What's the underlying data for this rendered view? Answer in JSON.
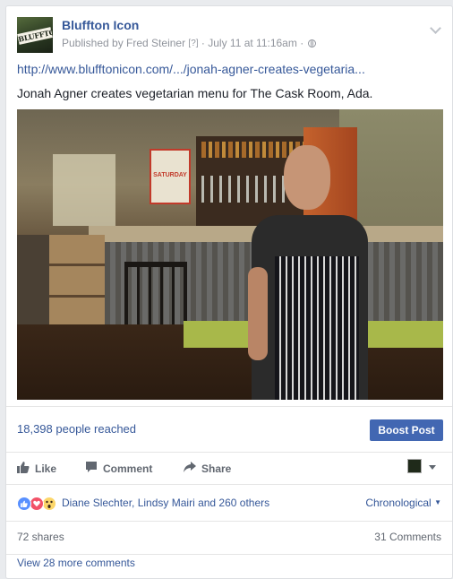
{
  "post": {
    "page_name": "Bluffton Icon",
    "avatar_text": "BLUFFTON",
    "published_by": "Published by Fred Steiner",
    "help_marker": "[?]",
    "separator": "·",
    "timestamp": "July 11 at 11:16am",
    "privacy_icon": "globe-icon",
    "link": "http://www.blufftonicon.com/.../jonah-agner-creates-vegetaria...",
    "caption": "Jonah Agner creates vegetarian menu for The Cask Room, Ada.",
    "photo_icon": "restaurant-photo",
    "poster_text": "SATURDAY"
  },
  "insights": {
    "reach": "18,398 people reached",
    "boost_label": "Boost Post"
  },
  "actions": {
    "like": "Like",
    "comment": "Comment",
    "share": "Share"
  },
  "reactions": {
    "icons": [
      "like-icon",
      "love-icon",
      "wow-icon"
    ],
    "names": "Diane Slechter, Lindsy Mairi and 260 others",
    "order_label": "Chronological",
    "shares": "72 shares",
    "comments": "31 Comments",
    "more_comments": "View 28 more comments"
  },
  "colors": {
    "link": "#365899",
    "boost": "#4267b2",
    "like": "#5890ff",
    "love": "#f25268",
    "wow": "#fcd669"
  }
}
